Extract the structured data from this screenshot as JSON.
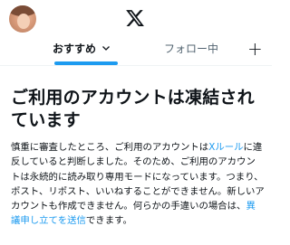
{
  "header": {
    "avatar_icon": "user-avatar-photo",
    "logo_icon": "x-logo-icon"
  },
  "tabs": [
    {
      "label": "おすすめ",
      "dropdown_icon": "chevron-down-icon",
      "selected": true
    },
    {
      "label": "フォロー中",
      "selected": false
    }
  ],
  "add_tab_icon": "plus-icon",
  "notice": {
    "title": "ご利用のアカウントは凍結されています",
    "body_part1": "慎重に審査したところ、ご利用のアカウントは",
    "rules_link": "Xルール",
    "body_part2": "に違反していると判断しました。そのため、ご利用のアカウントは永続的に読み取り専用モードになっています。つまり、ポスト、リポスト、いいねすることができません。新しいアカウントも作成できません。何らかの手違いの場合は、",
    "appeal_link": "異議申し立てを送信",
    "body_part3": "できます。"
  },
  "colors": {
    "accent": "#1d9bf0",
    "text": "#0f1419",
    "muted": "#536471"
  }
}
